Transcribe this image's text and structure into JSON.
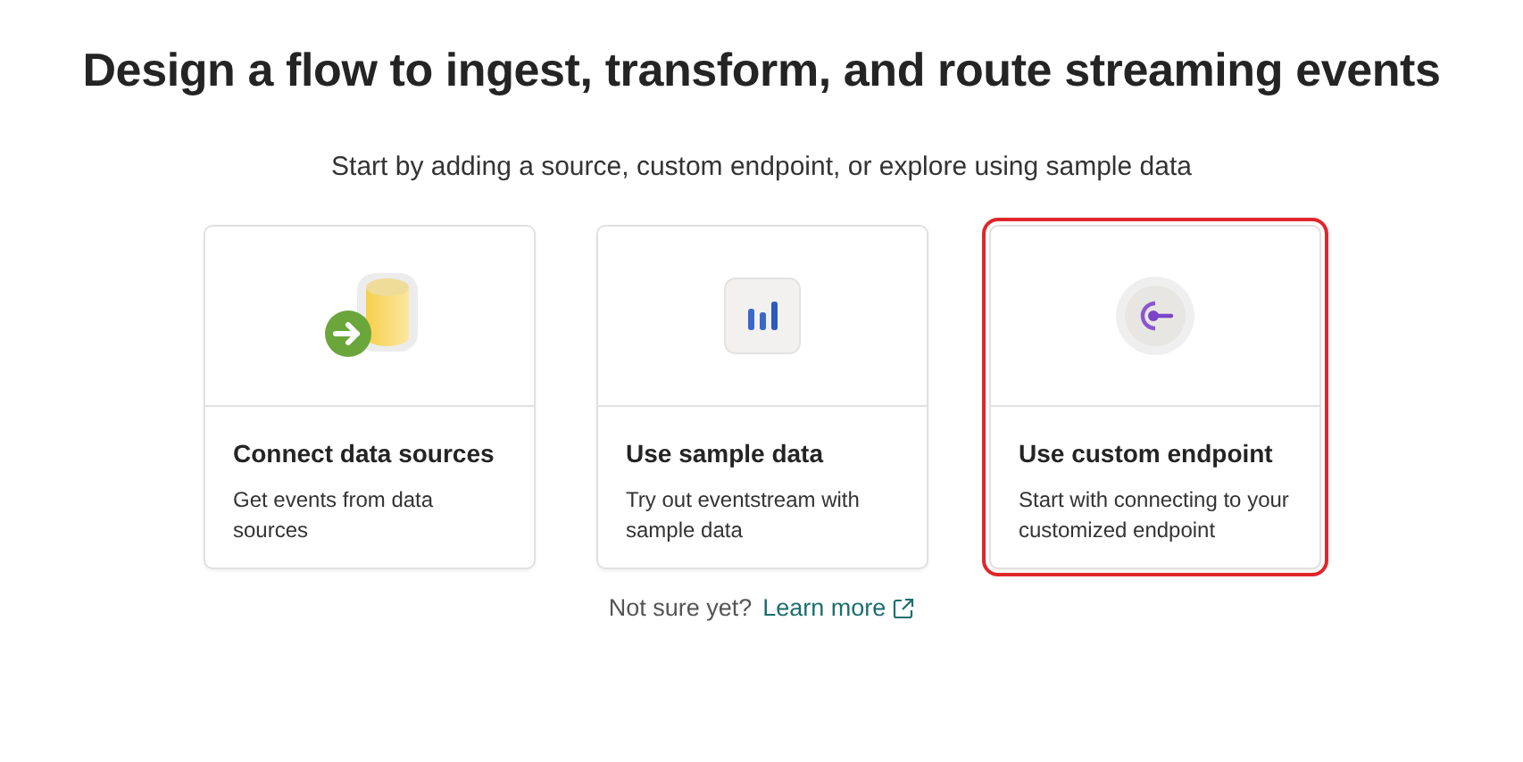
{
  "heading": "Design a flow to ingest, transform, and route streaming events",
  "subtitle": "Start by adding a source, custom endpoint, or explore using sample data",
  "cards": [
    {
      "kind": "database",
      "title": "Connect data sources",
      "description": "Get events from data sources",
      "highlighted": false
    },
    {
      "kind": "chart",
      "title": "Use sample data",
      "description": "Try out eventstream with sample data",
      "highlighted": false
    },
    {
      "kind": "endpoint",
      "title": "Use custom endpoint",
      "description": "Start with connecting to your customized endpoint",
      "highlighted": true
    }
  ],
  "footer": {
    "prompt": "Not sure yet?",
    "link": "Learn more"
  }
}
